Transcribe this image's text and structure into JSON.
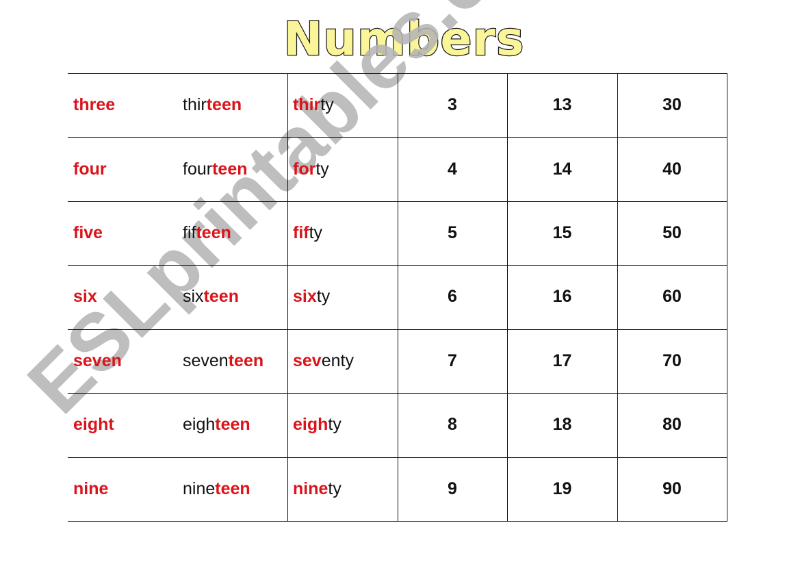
{
  "title": "Numbers",
  "watermark": "ESLprintables.com",
  "colors": {
    "highlight": "#d9141b",
    "text": "#111111",
    "title_fill": "#fbf59a",
    "watermark": "#b3b3b3"
  },
  "rows": [
    {
      "base": "three",
      "teen": {
        "plain": "thir",
        "bold": "teen"
      },
      "ty": {
        "bold": "thir",
        "plain": "ty"
      },
      "unit": "3",
      "teen_num": "13",
      "ty_num": "30"
    },
    {
      "base": "four",
      "teen": {
        "plain": "four",
        "bold": "teen"
      },
      "ty": {
        "bold": "for",
        "plain": "ty"
      },
      "unit": "4",
      "teen_num": "14",
      "ty_num": "40"
    },
    {
      "base": "five",
      "teen": {
        "plain": "fif",
        "bold": "teen"
      },
      "ty": {
        "bold": "fif",
        "plain": "ty"
      },
      "unit": "5",
      "teen_num": "15",
      "ty_num": "50"
    },
    {
      "base": "six",
      "teen": {
        "plain": "six",
        "bold": "teen"
      },
      "ty": {
        "bold": "six",
        "plain": "ty"
      },
      "unit": "6",
      "teen_num": "16",
      "ty_num": "60"
    },
    {
      "base": "seven",
      "teen": {
        "plain": "seven",
        "bold": "teen"
      },
      "ty": {
        "bold": "sev",
        "plain": "enty"
      },
      "unit": "7",
      "teen_num": "17",
      "ty_num": "70"
    },
    {
      "base": "eight",
      "teen": {
        "plain": "eigh",
        "bold": "teen"
      },
      "ty": {
        "bold": "eigh",
        "plain": "ty"
      },
      "unit": "8",
      "teen_num": "18",
      "ty_num": "80"
    },
    {
      "base": "nine",
      "teen": {
        "plain": "nine",
        "bold": "teen"
      },
      "ty": {
        "bold": "nine",
        "plain": "ty"
      },
      "unit": "9",
      "teen_num": "19",
      "ty_num": "90"
    }
  ]
}
